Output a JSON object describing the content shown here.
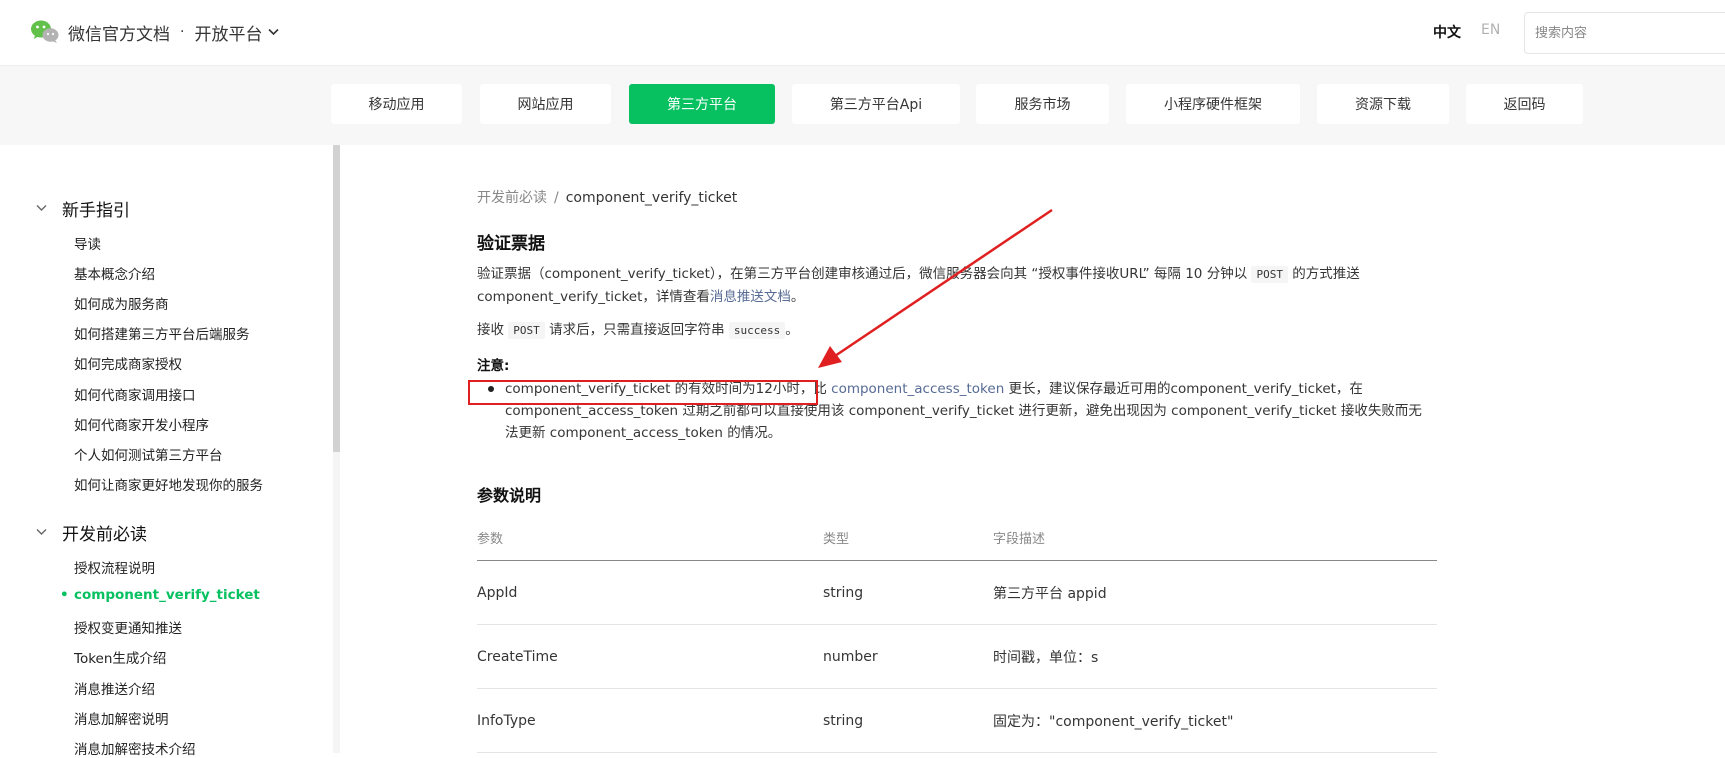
{
  "header": {
    "brand": "微信官方文档",
    "dot": "·",
    "platform": "开放平台",
    "lang_zh": "中文",
    "lang_en": "EN",
    "search_placeholder": "搜索内容"
  },
  "nav": {
    "items": [
      {
        "label": "移动应用"
      },
      {
        "label": "网站应用"
      },
      {
        "label": "第三方平台",
        "active": true
      },
      {
        "label": "第三方平台Api"
      },
      {
        "label": "服务市场"
      },
      {
        "label": "小程序硬件框架"
      },
      {
        "label": "资源下载"
      },
      {
        "label": "返回码"
      }
    ]
  },
  "sidebar": {
    "groups": [
      {
        "title": "新手指引",
        "items": [
          "导读",
          "基本概念介绍",
          "如何成为服务商",
          "如何搭建第三方平台后端服务",
          "如何完成商家授权",
          "如何代商家调用接口",
          "如何代商家开发小程序",
          "个人如何测试第三方平台",
          "如何让商家更好地发现你的服务"
        ]
      },
      {
        "title": "开发前必读",
        "items": [
          "授权流程说明",
          "component_verify_ticket",
          "授权变更通知推送",
          "Token生成介绍",
          "消息推送介绍",
          "消息加解密说明",
          "消息加解密技术介绍"
        ]
      }
    ],
    "active_item": "component_verify_ticket",
    "bullet": "•"
  },
  "content": {
    "breadcrumb": {
      "parent": "开发前必读",
      "separator": "/",
      "current": "component_verify_ticket"
    },
    "title": "验证票据",
    "para1_a": "验证票据（component_verify_ticket），在第三方平台创建审核通过后，微信服务器会向其 “授权事件接收URL” 每隔 10 分钟以 ",
    "para1_code": "POST",
    "para1_b": " 的方式推送 component_verify_ticket，详情查看",
    "para1_link": "消息推送文档",
    "para1_c": "。",
    "para2_a": "接收 ",
    "para2_code1": "POST",
    "para2_b": " 请求后，只需直接返回字符串 ",
    "para2_code2": "success",
    "para2_c": "。",
    "note_title": "注意:",
    "note_a": "component_verify_ticket 的有效时间为12小时，比 ",
    "note_link": "component_access_token",
    "note_b": " 更长，建议保存最近可用的component_verify_ticket，在 component_access_token 过期之前都可以直接使用该 component_verify_ticket 进行更新，避免出现因为 component_verify_ticket 接收失败而无法更新 component_access_token 的情况。",
    "params_title": "参数说明",
    "table": {
      "headers": [
        "参数",
        "类型",
        "字段描述"
      ],
      "rows": [
        [
          "AppId",
          "string",
          "第三方平台 appid"
        ],
        [
          "CreateTime",
          "number",
          "时间戳，单位：s"
        ],
        [
          "InfoType",
          "string",
          "固定为：\"component_verify_ticket\""
        ]
      ]
    }
  },
  "colors": {
    "accent": "#07c160",
    "link": "#576b95",
    "annotation": "#e02020"
  }
}
